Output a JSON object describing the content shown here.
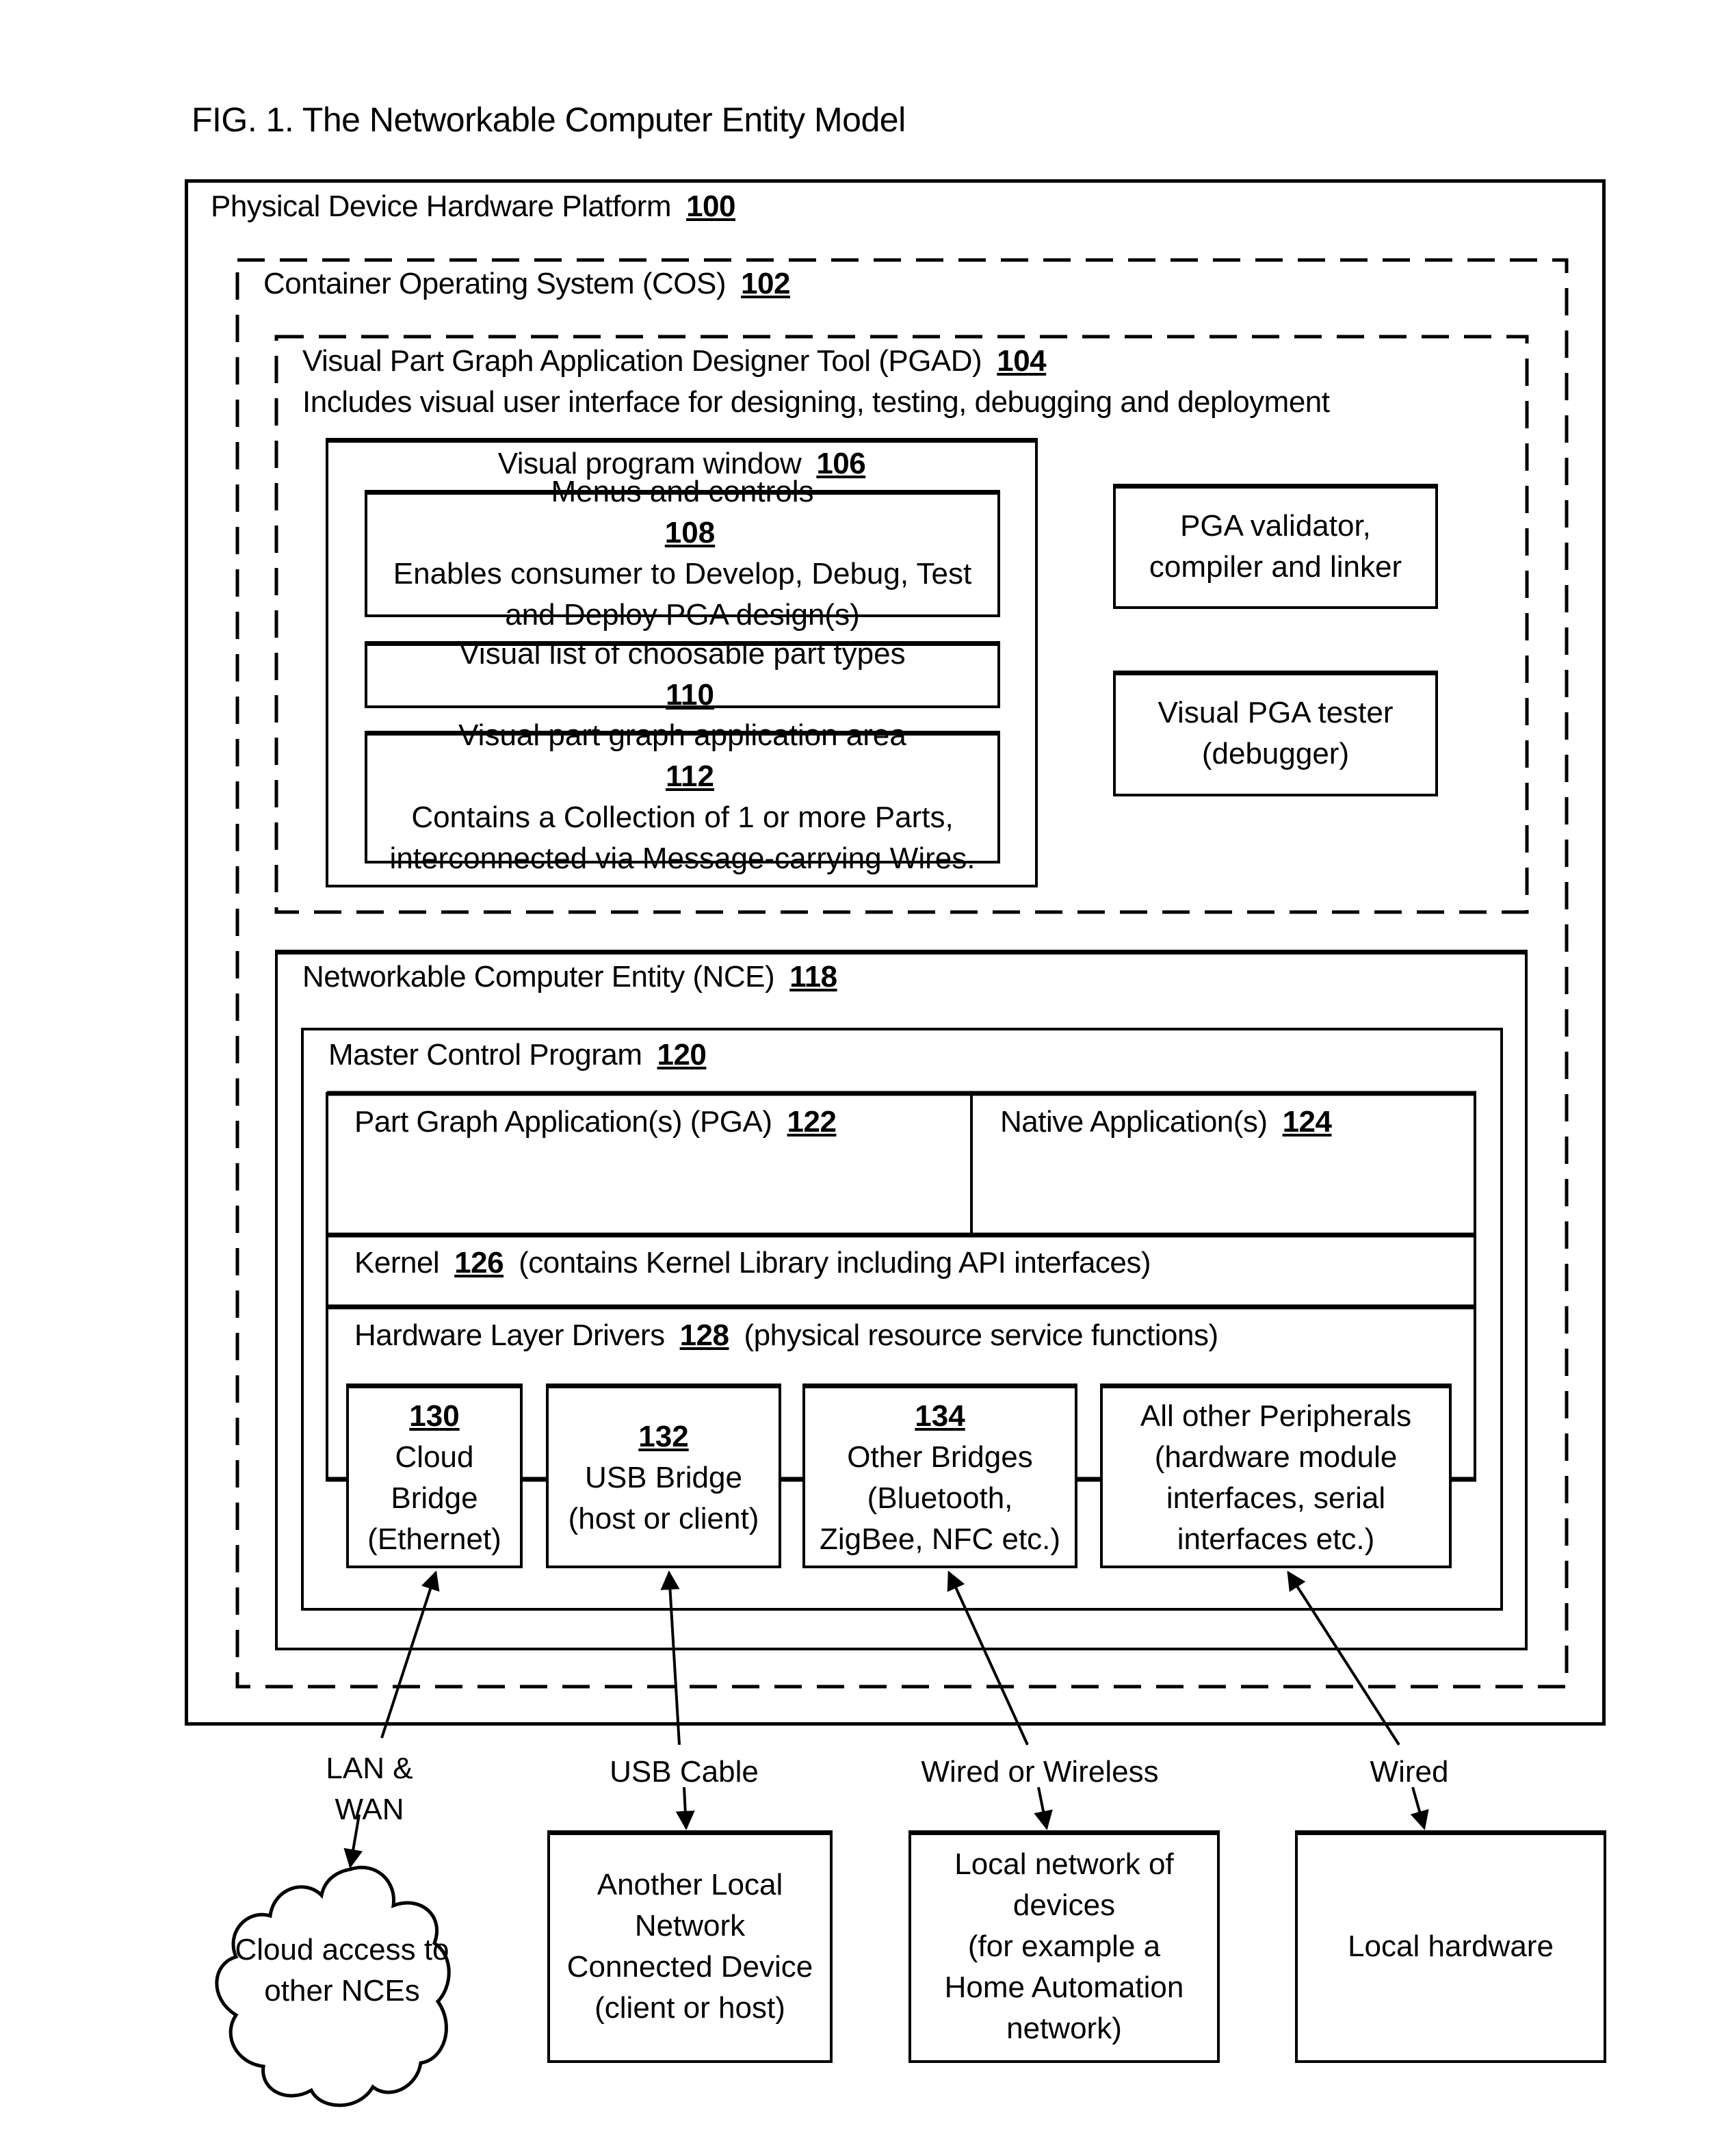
{
  "figure": {
    "title": "FIG. 1.  The Networkable Computer Entity Model"
  },
  "platform": {
    "label": "Physical Device Hardware Platform",
    "ref": "100"
  },
  "cos": {
    "label": "Container Operating System  (COS)",
    "ref": "102"
  },
  "pgad": {
    "label": "Visual Part Graph Application Designer Tool (PGAD)",
    "ref": "104",
    "description": "Includes visual user interface for designing, testing, debugging and deployment"
  },
  "program_window": {
    "label": "Visual program window",
    "ref": "106"
  },
  "menus": {
    "label": "Menus and controls",
    "ref": "108",
    "line2": "Enables consumer to Develop, Debug, Test",
    "line3": "and Deploy PGA design(s)"
  },
  "part_list": {
    "label": "Visual list of choosable part types",
    "ref": "110"
  },
  "app_area": {
    "label": "Visual part graph application area",
    "ref": "112",
    "line2": "Contains a Collection of 1 or more Parts,",
    "line3": "interconnected via Message-carrying Wires."
  },
  "validator": {
    "line1": "PGA validator,",
    "line2": "compiler and linker"
  },
  "tester": {
    "line1": "Visual PGA tester",
    "line2": "(debugger)"
  },
  "nce": {
    "label": "Networkable Computer Entity (NCE)",
    "ref": "118"
  },
  "mcp": {
    "label": "Master Control Program",
    "ref": "120"
  },
  "pga": {
    "label": "Part Graph Application(s) (PGA)",
    "ref": "122"
  },
  "native": {
    "label": "Native Application(s)",
    "ref": "124"
  },
  "kernel": {
    "label": "Kernel",
    "ref": "126",
    "note": "(contains Kernel Library including API interfaces)"
  },
  "hw_drivers": {
    "label": "Hardware Layer Drivers",
    "ref": "128",
    "note": "(physical resource service functions)"
  },
  "bridges": [
    {
      "ref": "130",
      "lines": [
        "Cloud",
        "Bridge",
        "(Ethernet)"
      ]
    },
    {
      "ref": "132",
      "lines": [
        "USB Bridge",
        "(host or client)"
      ]
    },
    {
      "ref": "134",
      "lines": [
        "Other Bridges",
        "(Bluetooth,",
        "ZigBee, NFC etc.)"
      ]
    },
    {
      "ref": "",
      "lines": [
        "All other Peripherals",
        "(hardware module",
        "interfaces, serial",
        "interfaces etc.)"
      ]
    }
  ],
  "connections": [
    {
      "label_lines": [
        "LAN &",
        "WAN"
      ]
    },
    {
      "label_lines": [
        "USB Cable"
      ]
    },
    {
      "label_lines": [
        "Wired or Wireless"
      ]
    },
    {
      "label_lines": [
        "Wired"
      ]
    }
  ],
  "external": {
    "cloud": {
      "lines": [
        "Cloud access to",
        "other NCEs"
      ]
    },
    "device": {
      "lines": [
        "Another Local",
        "Network",
        "Connected Device",
        "(client or host)"
      ]
    },
    "local_network": {
      "lines": [
        "Local network of",
        "devices",
        "(for example a",
        "Home Automation",
        "network)"
      ]
    },
    "local_hw": {
      "lines": [
        "Local hardware"
      ]
    }
  }
}
